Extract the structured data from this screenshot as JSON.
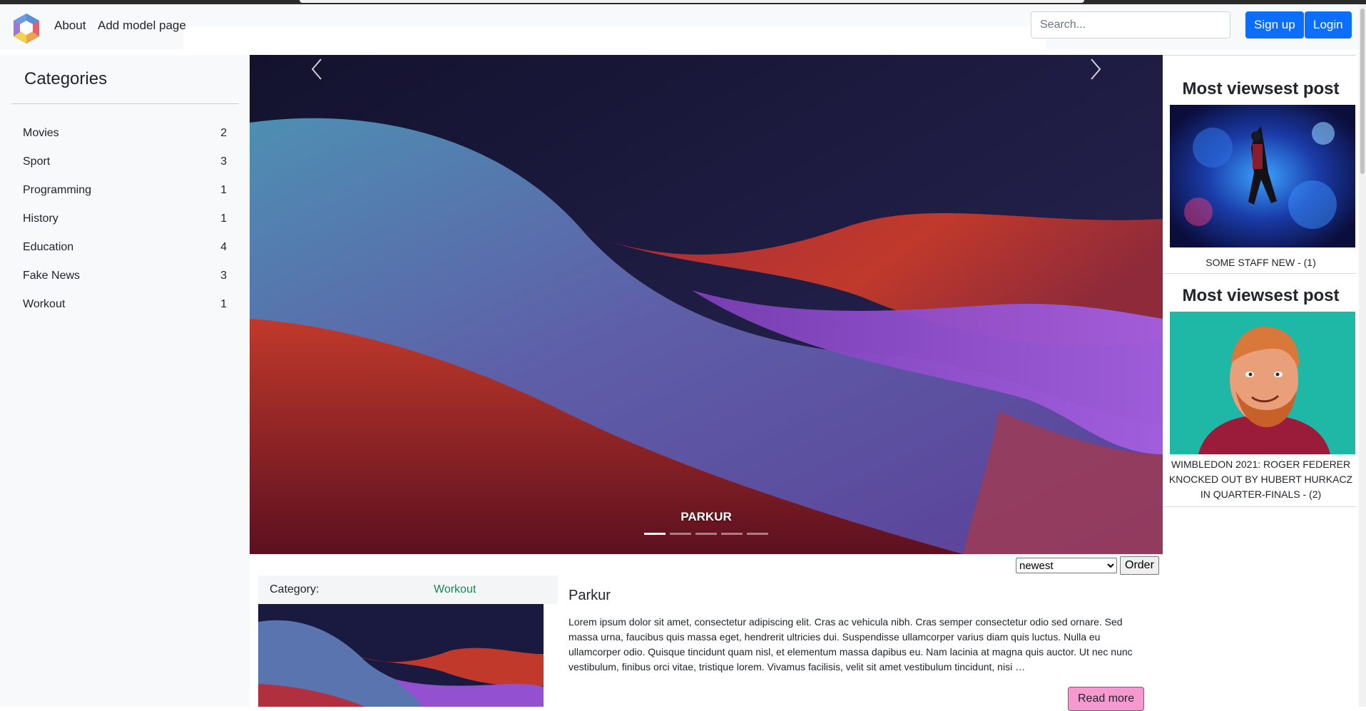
{
  "nav": {
    "about": "About",
    "add_model": "Add model page",
    "search_placeholder": "Search...",
    "signup": "Sign up",
    "login": "Login"
  },
  "sidebar": {
    "title": "Categories",
    "items": [
      {
        "label": "Movies",
        "count": "2"
      },
      {
        "label": "Sport",
        "count": "3"
      },
      {
        "label": "Programming",
        "count": "1"
      },
      {
        "label": "History",
        "count": "1"
      },
      {
        "label": "Education",
        "count": "4"
      },
      {
        "label": "Fake News",
        "count": "3"
      },
      {
        "label": "Workout",
        "count": "1"
      }
    ]
  },
  "carousel": {
    "caption": "PARKUR",
    "slide_count": 5,
    "active_index": 0
  },
  "order": {
    "selected": "newest",
    "button": "Order"
  },
  "post": {
    "category_label": "Category:",
    "category_value": "Workout",
    "title": "Parkur",
    "excerpt": "Lorem ipsum dolor sit amet, consectetur adipiscing elit. Cras ac vehicula nibh. Cras semper consectetur odio sed ornare. Sed massa urna, faucibus quis massa eget, hendrerit ultricies dui. Suspendisse ullamcorper varius diam quis luctus. Nulla eu ullamcorper odio. Quisque tincidunt quam nisl, et elementum massa dapibus eu. Nam lacinia at magna quis auctor. Ut nec nunc vestibulum, finibus orci vitae, tristique lorem. Vivamus facilisis, velit sit amet vestibulum tincidunt, nisi …",
    "read_more": "Read more"
  },
  "right": {
    "blocks": [
      {
        "title": "Most viewsest post",
        "caption": "SOME STAFF NEW - (1)"
      },
      {
        "title": "Most viewsest post",
        "caption": "WIMBLEDON 2021: ROGER FEDERER KNOCKED OUT BY HUBERT HURKACZ IN QUARTER-FINALS - (2)"
      }
    ]
  },
  "colors": {
    "primary": "#0d6efd",
    "category_green": "#198754",
    "read_more_pink": "#f49ad0"
  }
}
